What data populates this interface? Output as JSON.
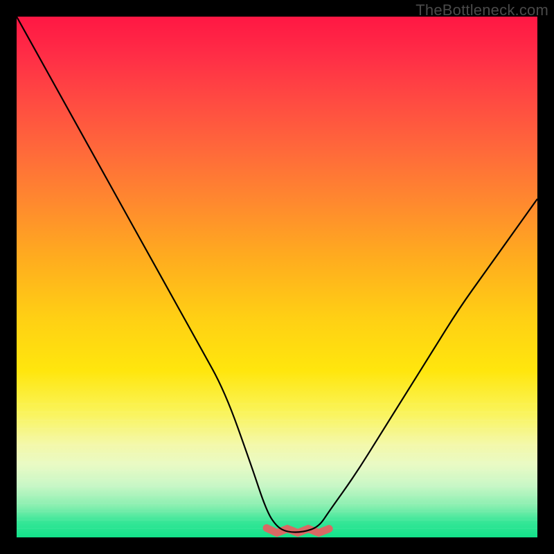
{
  "watermark": "TheBottleneck.com",
  "colors": {
    "background": "#000000",
    "curve": "#000000",
    "minimum_marker": "#d86a64",
    "gradient_top": "#ff1744",
    "gradient_mid": "#ffd014",
    "gradient_bottom": "#12e28a"
  },
  "chart_data": {
    "type": "line",
    "title": "",
    "xlabel": "",
    "ylabel": "",
    "xlim": [
      0,
      100
    ],
    "ylim": [
      0,
      100
    ],
    "x": [
      0,
      5,
      10,
      15,
      20,
      25,
      30,
      35,
      40,
      45,
      48,
      50,
      52,
      55,
      58,
      60,
      65,
      70,
      75,
      80,
      85,
      90,
      95,
      100
    ],
    "values": [
      100,
      91,
      82,
      73,
      64,
      55,
      46,
      37,
      28,
      14,
      5,
      2,
      1,
      1,
      2,
      5,
      12,
      20,
      28,
      36,
      44,
      51,
      58,
      65
    ],
    "minimum_range_x": [
      48,
      60
    ],
    "minimum_value": 1,
    "note": "Values are read as percent-of-plot-height from bottom; x as percent across plot width. Curve is a V-shaped bottleneck profile with a slightly flat minimum plateau roughly between x=50 and x=58."
  }
}
